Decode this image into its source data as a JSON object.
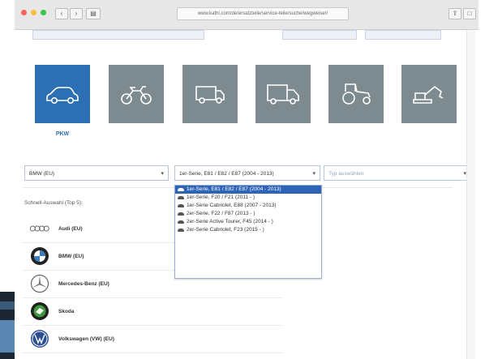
{
  "browser": {
    "url": "www.kathi.com/de/ersatzteile/service-teile/suche/wegweiser/",
    "tab_left": "‹ ›",
    "right_buttons": [
      "⇪",
      "□"
    ]
  },
  "vehicle_types": [
    {
      "name": "PKW",
      "icon": "car-icon",
      "active": true
    },
    {
      "name": "",
      "icon": "motorcycle-icon",
      "active": false
    },
    {
      "name": "",
      "icon": "van-icon",
      "active": false
    },
    {
      "name": "",
      "icon": "truck-icon",
      "active": false
    },
    {
      "name": "",
      "icon": "tractor-icon",
      "active": false
    },
    {
      "name": "",
      "icon": "excavator-icon",
      "active": false
    }
  ],
  "filters": {
    "brand": "BMW (EU)",
    "model": "1er-Serie, E81 / E82 / E87 (2004 - 2013)",
    "type_placeholder": "Typ auswählen"
  },
  "model_options": [
    "1er-Serie, E81 / E82 / E87 (2004 - 2013)",
    "1er-Serie, F20 / F21 (2011 - )",
    "1er-Serie Cabriolet, E88 (2007 - 2013)",
    "2er-Serie, F22 / F87 (2013 - )",
    "2er-Serie Active Tourer, F45 (2014 - )",
    "2er-Serie Cabriolet, F23 (2015 - )"
  ],
  "quick_select_label": "Schnell-Auswahl (Top 5):",
  "brands": [
    {
      "name": "Audi (EU)",
      "icon": "audi-logo-icon"
    },
    {
      "name": "BMW (EU)",
      "icon": "bmw-logo-icon"
    },
    {
      "name": "Mercedes-Benz (EU)",
      "icon": "mercedes-logo-icon"
    },
    {
      "name": "Skoda",
      "icon": "skoda-logo-icon"
    },
    {
      "name": "Volkswagen (VW) (EU)",
      "icon": "vw-logo-icon"
    }
  ],
  "colors": {
    "active_tile": "#2d6fb3",
    "inactive_tile": "#7d8a8f",
    "highlight": "#2e64b5"
  }
}
